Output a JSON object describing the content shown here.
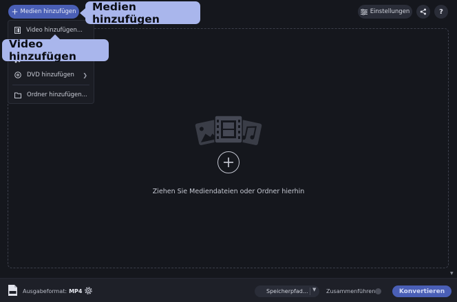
{
  "topbar": {
    "add_media_label": "Medien hinzufügen",
    "settings_label": "Einstellungen",
    "help_label": "?"
  },
  "callouts": {
    "media": "Medien hinzufügen",
    "video": "Video hinzufügen"
  },
  "menu": {
    "items": [
      {
        "label": "Video hinzufügen...",
        "icon": "video-file-icon"
      },
      {
        "label": "",
        "icon": "audio-file-icon"
      },
      {
        "label": "DVD hinzufügen",
        "icon": "dvd-icon",
        "has_submenu": true
      },
      {
        "label": "Ordner hinzufügen...",
        "icon": "folder-icon"
      }
    ]
  },
  "dropzone": {
    "hint": "Ziehen Sie Mediendateien oder Ordner hierhin"
  },
  "bottombar": {
    "format_label": "Ausgabeformat:",
    "format_value": "MP4",
    "save_path_label": "Speicherpfad...",
    "merge_label": "Zusammenführen:",
    "convert_label": "Konvertieren"
  },
  "colors": {
    "background": "#15171d",
    "accent": "#4a5fb6",
    "callout": "#a9b6ec"
  }
}
